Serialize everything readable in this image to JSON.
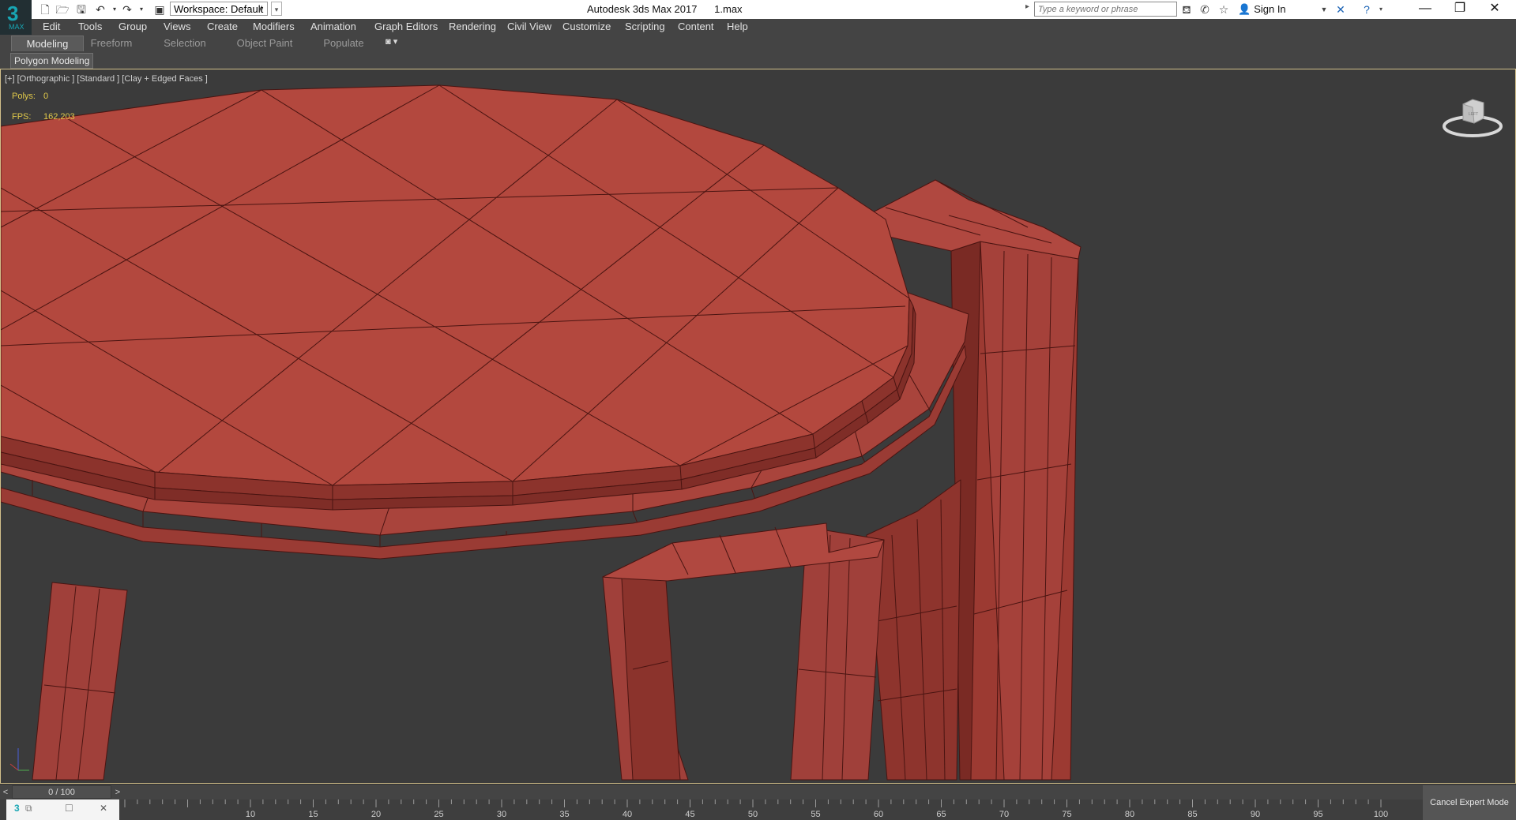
{
  "app": {
    "logo_text": "3",
    "logo_sub": "MAX",
    "title": "Autodesk 3ds Max 2017      1.max",
    "workspace": "Workspace: Default"
  },
  "search": {
    "placeholder": "Type a keyword or phrase"
  },
  "signin": {
    "label": "Sign In"
  },
  "menu": [
    "Edit",
    "Tools",
    "Group",
    "Views",
    "Create",
    "Modifiers",
    "Animation",
    "Graph Editors",
    "Rendering",
    "Civil View",
    "Customize",
    "Scripting",
    "Content",
    "Help"
  ],
  "ribbon": {
    "tabs": [
      "Modeling",
      "Freeform",
      "Selection",
      "Object Paint",
      "Populate"
    ],
    "active_tab": "Modeling",
    "panel_label": "Polygon Modeling"
  },
  "viewport": {
    "label": "[+] [Orthographic ] [Standard ] [Clay + Edged Faces ]",
    "stats": {
      "polys_label": "Polys:",
      "polys_value": "0",
      "fps_label": "FPS:",
      "fps_value": "162,203"
    },
    "viewcube_face": "LEFT",
    "model_color": "#b3483e"
  },
  "timeline": {
    "frame_display": "0 / 100",
    "ticks": [
      "10",
      "15",
      "20",
      "25",
      "30",
      "35",
      "40",
      "45",
      "50",
      "55",
      "60",
      "65",
      "70",
      "75",
      "80",
      "85",
      "90",
      "95",
      "100"
    ]
  },
  "status": {
    "cancel_expert_label": "Cancel Expert Mode"
  },
  "colors": {
    "ui_bg": "#444444",
    "viewport_bg": "#3b3b3b",
    "accent": "#18a6b4",
    "stat_text": "#e0c94a"
  }
}
